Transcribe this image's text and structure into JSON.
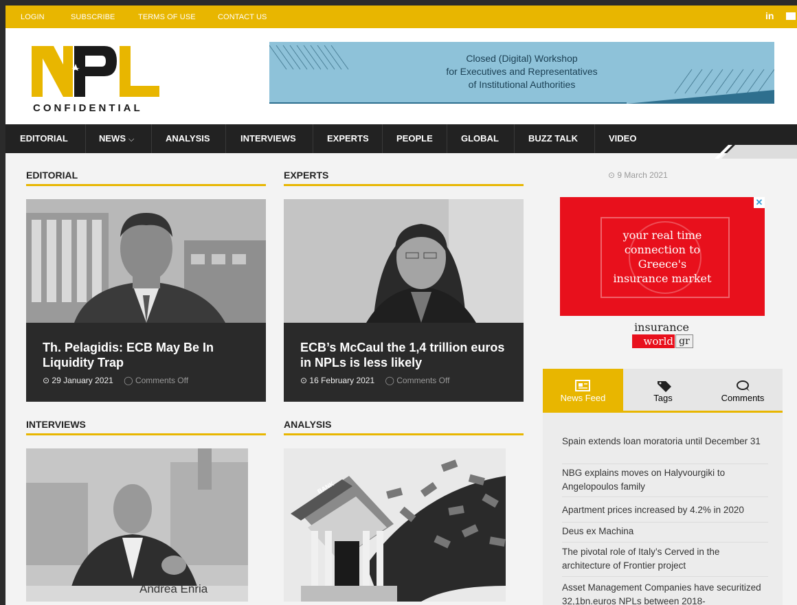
{
  "topbar": {
    "links": [
      "LOGIN",
      "SUBSCRIBE",
      "TERMS OF USE",
      "CONTACT US"
    ],
    "social": "in"
  },
  "logo": {
    "text": "CONFIDENTIAL",
    "letters": "NPL"
  },
  "banner": {
    "line1": "Closed (Digital) Workshop",
    "line2": "for Executives and Representatives",
    "line3": "of Institutional Authorities"
  },
  "nav": {
    "items": [
      "EDITORIAL",
      "NEWS",
      "ANALYSIS",
      "INTERVIEWS",
      "EXPERTS",
      "PEOPLE",
      "GLOBAL",
      "BUZZ TALK",
      "VIDEO"
    ],
    "news_caret": "⌵"
  },
  "sections": {
    "editorial": "EDITORIAL",
    "experts": "EXPERTS",
    "interviews": "INTERVIEWS",
    "analysis": "ANALYSIS"
  },
  "cards": {
    "editorial": {
      "title": "Th. Pelagidis: ECB May Be In Liquidity Trap",
      "date": "29 January 2021",
      "comments": "Comments Off"
    },
    "experts": {
      "title": "ECB’s McCaul the 1,4 trillion euros in NPLs is less likely",
      "date": "16 February 2021",
      "comments": "Comments Off"
    }
  },
  "interview_caption": "Andrea Enria",
  "analysis_bank_label": "BANK",
  "sidebar": {
    "date": "9 March 2021",
    "ad": {
      "line1": "your real time",
      "line2": "connection to",
      "line3": "Greece's",
      "line4": "insurance market",
      "brand1": "insurance",
      "brand2": "world",
      "brand3": "gr",
      "close": "✕"
    },
    "tabs": [
      "News Feed",
      "Tags",
      "Comments"
    ],
    "feed": [
      "Spain extends loan moratoria until December 31",
      "NBG explains moves on Halyvourgiki to Angelopoulos family",
      "Apartment prices increased by 4.2% in 2020",
      "Deus ex Machina",
      "The pivotal role of Italy’s Cerved in the architecture of Frontier project",
      "Asset Management Companies have securitized 32,1bn.euros NPLs between 2018-"
    ]
  },
  "colors": {
    "accent": "#e8b600",
    "nav": "#222222",
    "card": "#2a2a2a",
    "ad_red": "#e8101c"
  }
}
